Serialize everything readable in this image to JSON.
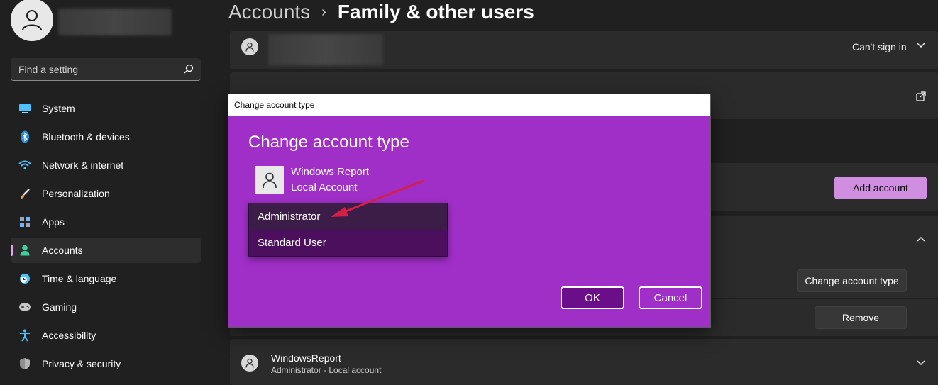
{
  "sidebar": {
    "search_placeholder": "Find a setting",
    "items": [
      {
        "label": "System",
        "icon": "monitor-icon"
      },
      {
        "label": "Bluetooth & devices",
        "icon": "bluetooth-icon"
      },
      {
        "label": "Network & internet",
        "icon": "wifi-icon"
      },
      {
        "label": "Personalization",
        "icon": "brush-icon"
      },
      {
        "label": "Apps",
        "icon": "apps-icon"
      },
      {
        "label": "Accounts",
        "icon": "person-icon",
        "active": true
      },
      {
        "label": "Time & language",
        "icon": "globe-clock-icon"
      },
      {
        "label": "Gaming",
        "icon": "gamepad-icon"
      },
      {
        "label": "Accessibility",
        "icon": "accessibility-icon"
      },
      {
        "label": "Privacy & security",
        "icon": "shield-icon"
      }
    ]
  },
  "breadcrumb": {
    "parent": "Accounts",
    "current": "Family & other users"
  },
  "main": {
    "family_row": {
      "status": "Can't sign in"
    },
    "add_account_label": "Add account",
    "change_account_type_label": "Change account type",
    "remove_label": "Remove",
    "other_user": {
      "name": "WindowsReport",
      "detail": "Administrator - Local account"
    }
  },
  "dialog": {
    "window_title": "Change account type",
    "heading": "Change account type",
    "user_name": "Windows Report",
    "user_type": "Local Account",
    "options": [
      "Administrator",
      "Standard User"
    ],
    "selected_option": "Standard User",
    "ok_label": "OK",
    "cancel_label": "Cancel"
  },
  "colors": {
    "accent": "#d08ee0",
    "dialog_background": "#a02fc8",
    "ok_button": "#6b0e8a",
    "annotation_arrow": "#d61f45"
  }
}
